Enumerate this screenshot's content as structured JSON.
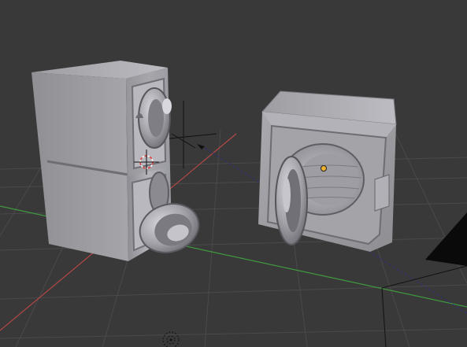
{
  "viewport": {
    "background_color": "#393939",
    "grid_color": "#4a4a4a",
    "x_axis_color": "#b34646",
    "y_axis_color": "#3f9a3f",
    "relationship_line_color": "#2a2a7a",
    "origin_color": "#f0b030",
    "mesh_color": "#a8a8ac"
  },
  "objects": [
    {
      "kind": "stacked-washer-dryer",
      "icon": "washing-machine-icon"
    },
    {
      "kind": "single-washing-machine",
      "icon": "washing-machine-icon"
    },
    {
      "kind": "camera",
      "icon": "camera-icon"
    },
    {
      "kind": "lamp",
      "icon": "lamp-icon"
    },
    {
      "kind": "3d-cursor",
      "icon": "crosshair-icon"
    }
  ]
}
